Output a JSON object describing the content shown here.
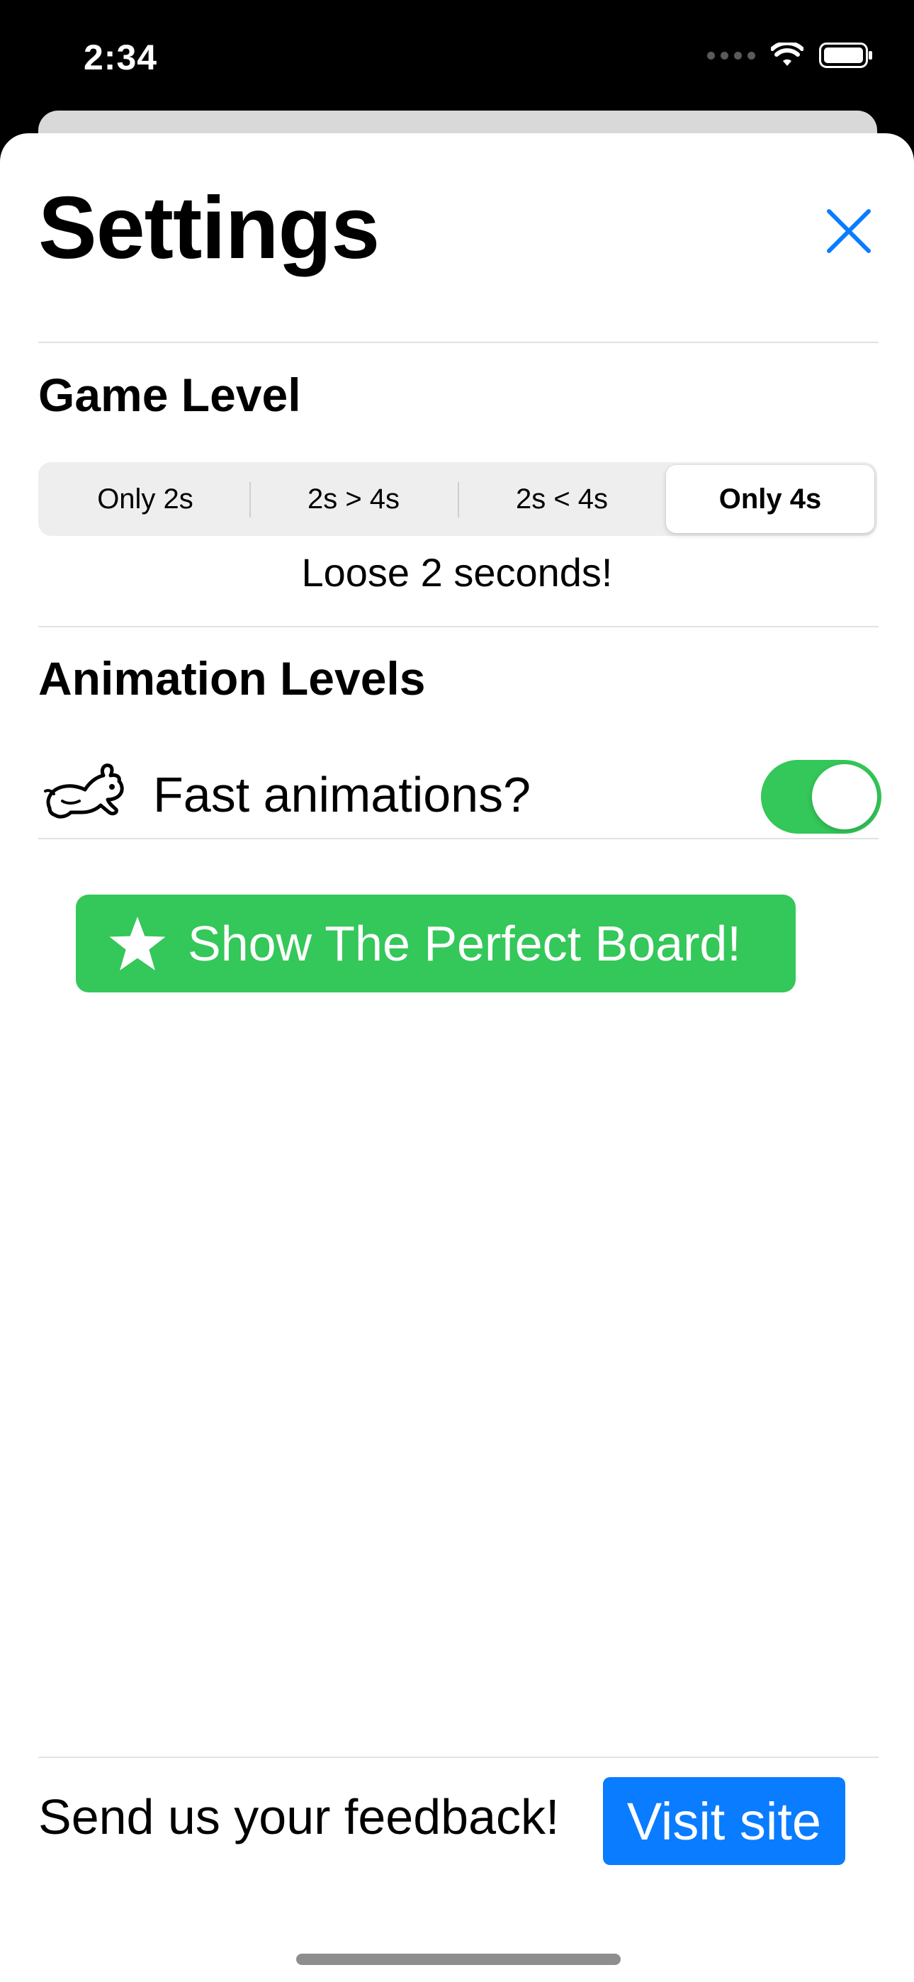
{
  "status_bar": {
    "time": "2:34",
    "icons": [
      "signal-dots-icon",
      "wifi-icon",
      "battery-icon"
    ]
  },
  "settings": {
    "title": "Settings",
    "close_icon": "close-icon"
  },
  "game_level": {
    "title": "Game Level",
    "options": [
      "Only 2s",
      "2s > 4s",
      "2s < 4s",
      "Only 4s"
    ],
    "selected": "Only 4s",
    "caption": "Loose 2 seconds!"
  },
  "animation": {
    "title": "Animation Levels",
    "icon": "rabbit-icon",
    "label": "Fast animations?",
    "enabled": true
  },
  "perfect_board": {
    "icon": "star-icon",
    "label": "Show The Perfect Board!"
  },
  "footer": {
    "feedback": "Send us your feedback!",
    "visit_label": "Visit site"
  },
  "colors": {
    "accent_blue": "#0a7cff",
    "green": "#34c759"
  }
}
